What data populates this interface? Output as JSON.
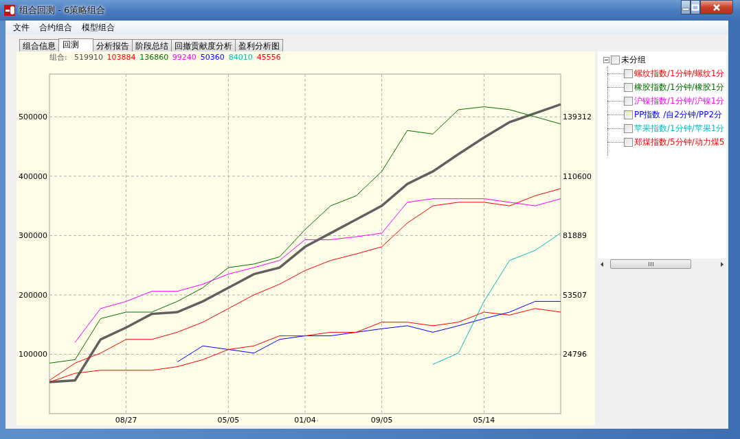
{
  "window": {
    "title": "组合回测 - 6策略组合"
  },
  "menu": [
    "文件",
    "合约组合",
    "模型组合"
  ],
  "tabs": [
    {
      "label": "组合信息",
      "selected": false
    },
    {
      "label": "回测",
      "selected": true
    },
    {
      "label": "分析报告",
      "selected": false
    },
    {
      "label": "阶段总结",
      "selected": false
    },
    {
      "label": "回撤贡献度分析",
      "selected": false
    },
    {
      "label": "盈利分析图",
      "selected": false
    }
  ],
  "legend": {
    "label": "组合:",
    "values": [
      {
        "text": "519910",
        "color": "#505050"
      },
      {
        "text": "103884",
        "color": "#ff0000"
      },
      {
        "text": "136860",
        "color": "#007000"
      },
      {
        "text": "99240",
        "color": "#ff00ff"
      },
      {
        "text": "50360",
        "color": "#0000ff"
      },
      {
        "text": "84010",
        "color": "#00c0c0"
      },
      {
        "text": "45556",
        "color": "#ff0000"
      }
    ]
  },
  "right_axis_ticks": [
    "139312",
    "110600",
    "81889",
    "53507",
    "24796"
  ],
  "chart_data": {
    "type": "line",
    "grid": true,
    "ylim": [
      0,
      572000
    ],
    "categories": [
      null,
      null,
      null,
      "08/27",
      null,
      null,
      null,
      "05/05",
      null,
      null,
      "01/04",
      null,
      null,
      "09/05",
      null,
      null,
      null,
      "05/14",
      null,
      null,
      null
    ],
    "yticks": [
      100000,
      200000,
      300000,
      400000,
      500000
    ],
    "series": [
      {
        "color": "#606060",
        "values": [
          53000,
          56000,
          125000,
          145000,
          168000,
          171000,
          189000,
          212000,
          235000,
          246000,
          281000,
          304000,
          327000,
          350000,
          387000,
          408000,
          437000,
          465000,
          491000,
          506000,
          521000
        ]
      },
      {
        "color": "#ff0000",
        "values": [
          56000,
          85000,
          102000,
          125000,
          125000,
          137000,
          154000,
          177000,
          200000,
          218000,
          241000,
          258000,
          269000,
          281000,
          321000,
          350000,
          356000,
          356000,
          350000,
          367000,
          379000
        ]
      },
      {
        "color": "#007000",
        "values": [
          85000,
          91000,
          160000,
          171000,
          171000,
          189000,
          212000,
          246000,
          252000,
          264000,
          310000,
          350000,
          367000,
          408000,
          477000,
          471000,
          512000,
          517000,
          512000,
          500000,
          488000
        ]
      },
      {
        "color": "#ff00ff",
        "values": [
          null,
          120000,
          177000,
          189000,
          206000,
          206000,
          218000,
          235000,
          246000,
          258000,
          293000,
          293000,
          298000,
          304000,
          356000,
          362000,
          362000,
          362000,
          356000,
          350000,
          362000
        ]
      },
      {
        "color": "#0000ff",
        "values": [
          null,
          null,
          null,
          null,
          null,
          87000,
          114000,
          108000,
          102000,
          125000,
          131000,
          131000,
          137000,
          143000,
          148000,
          137000,
          148000,
          160000,
          171000,
          189000,
          189000
        ]
      },
      {
        "color": "#00c0c0",
        "values": [
          null,
          null,
          null,
          null,
          null,
          null,
          null,
          null,
          null,
          null,
          null,
          null,
          null,
          null,
          null,
          83000,
          102000,
          189000,
          258000,
          275000,
          304000
        ]
      },
      {
        "color": "#ff0000",
        "values": [
          53000,
          68000,
          73000,
          73000,
          73000,
          79000,
          91000,
          108000,
          114000,
          131000,
          131000,
          137000,
          137000,
          154000,
          154000,
          148000,
          154000,
          171000,
          166000,
          177000,
          171000
        ]
      }
    ]
  },
  "tree": {
    "label": "未分组",
    "expanded": true,
    "checked": false,
    "children": [
      {
        "label": "螺纹指数/1分钟/螺纹1分",
        "checked": false,
        "color": "#ff0000"
      },
      {
        "label": "橡胶指数/1分钟/橡胶1分",
        "checked": false,
        "color": "#007000"
      },
      {
        "label": "沪镍指数/1分钟/沪镍1分",
        "checked": false,
        "color": "#ff00ff"
      },
      {
        "label": "PP指数  /自2分钟/PP2分",
        "checked": false,
        "color": "#0000ff"
      },
      {
        "label": "苹果指数/1分钟/苹果1分",
        "checked": false,
        "color": "#00c0c0"
      },
      {
        "label": "郑煤指数/5分钟/动力煤5",
        "checked": false,
        "color": "#ff0000"
      }
    ]
  }
}
